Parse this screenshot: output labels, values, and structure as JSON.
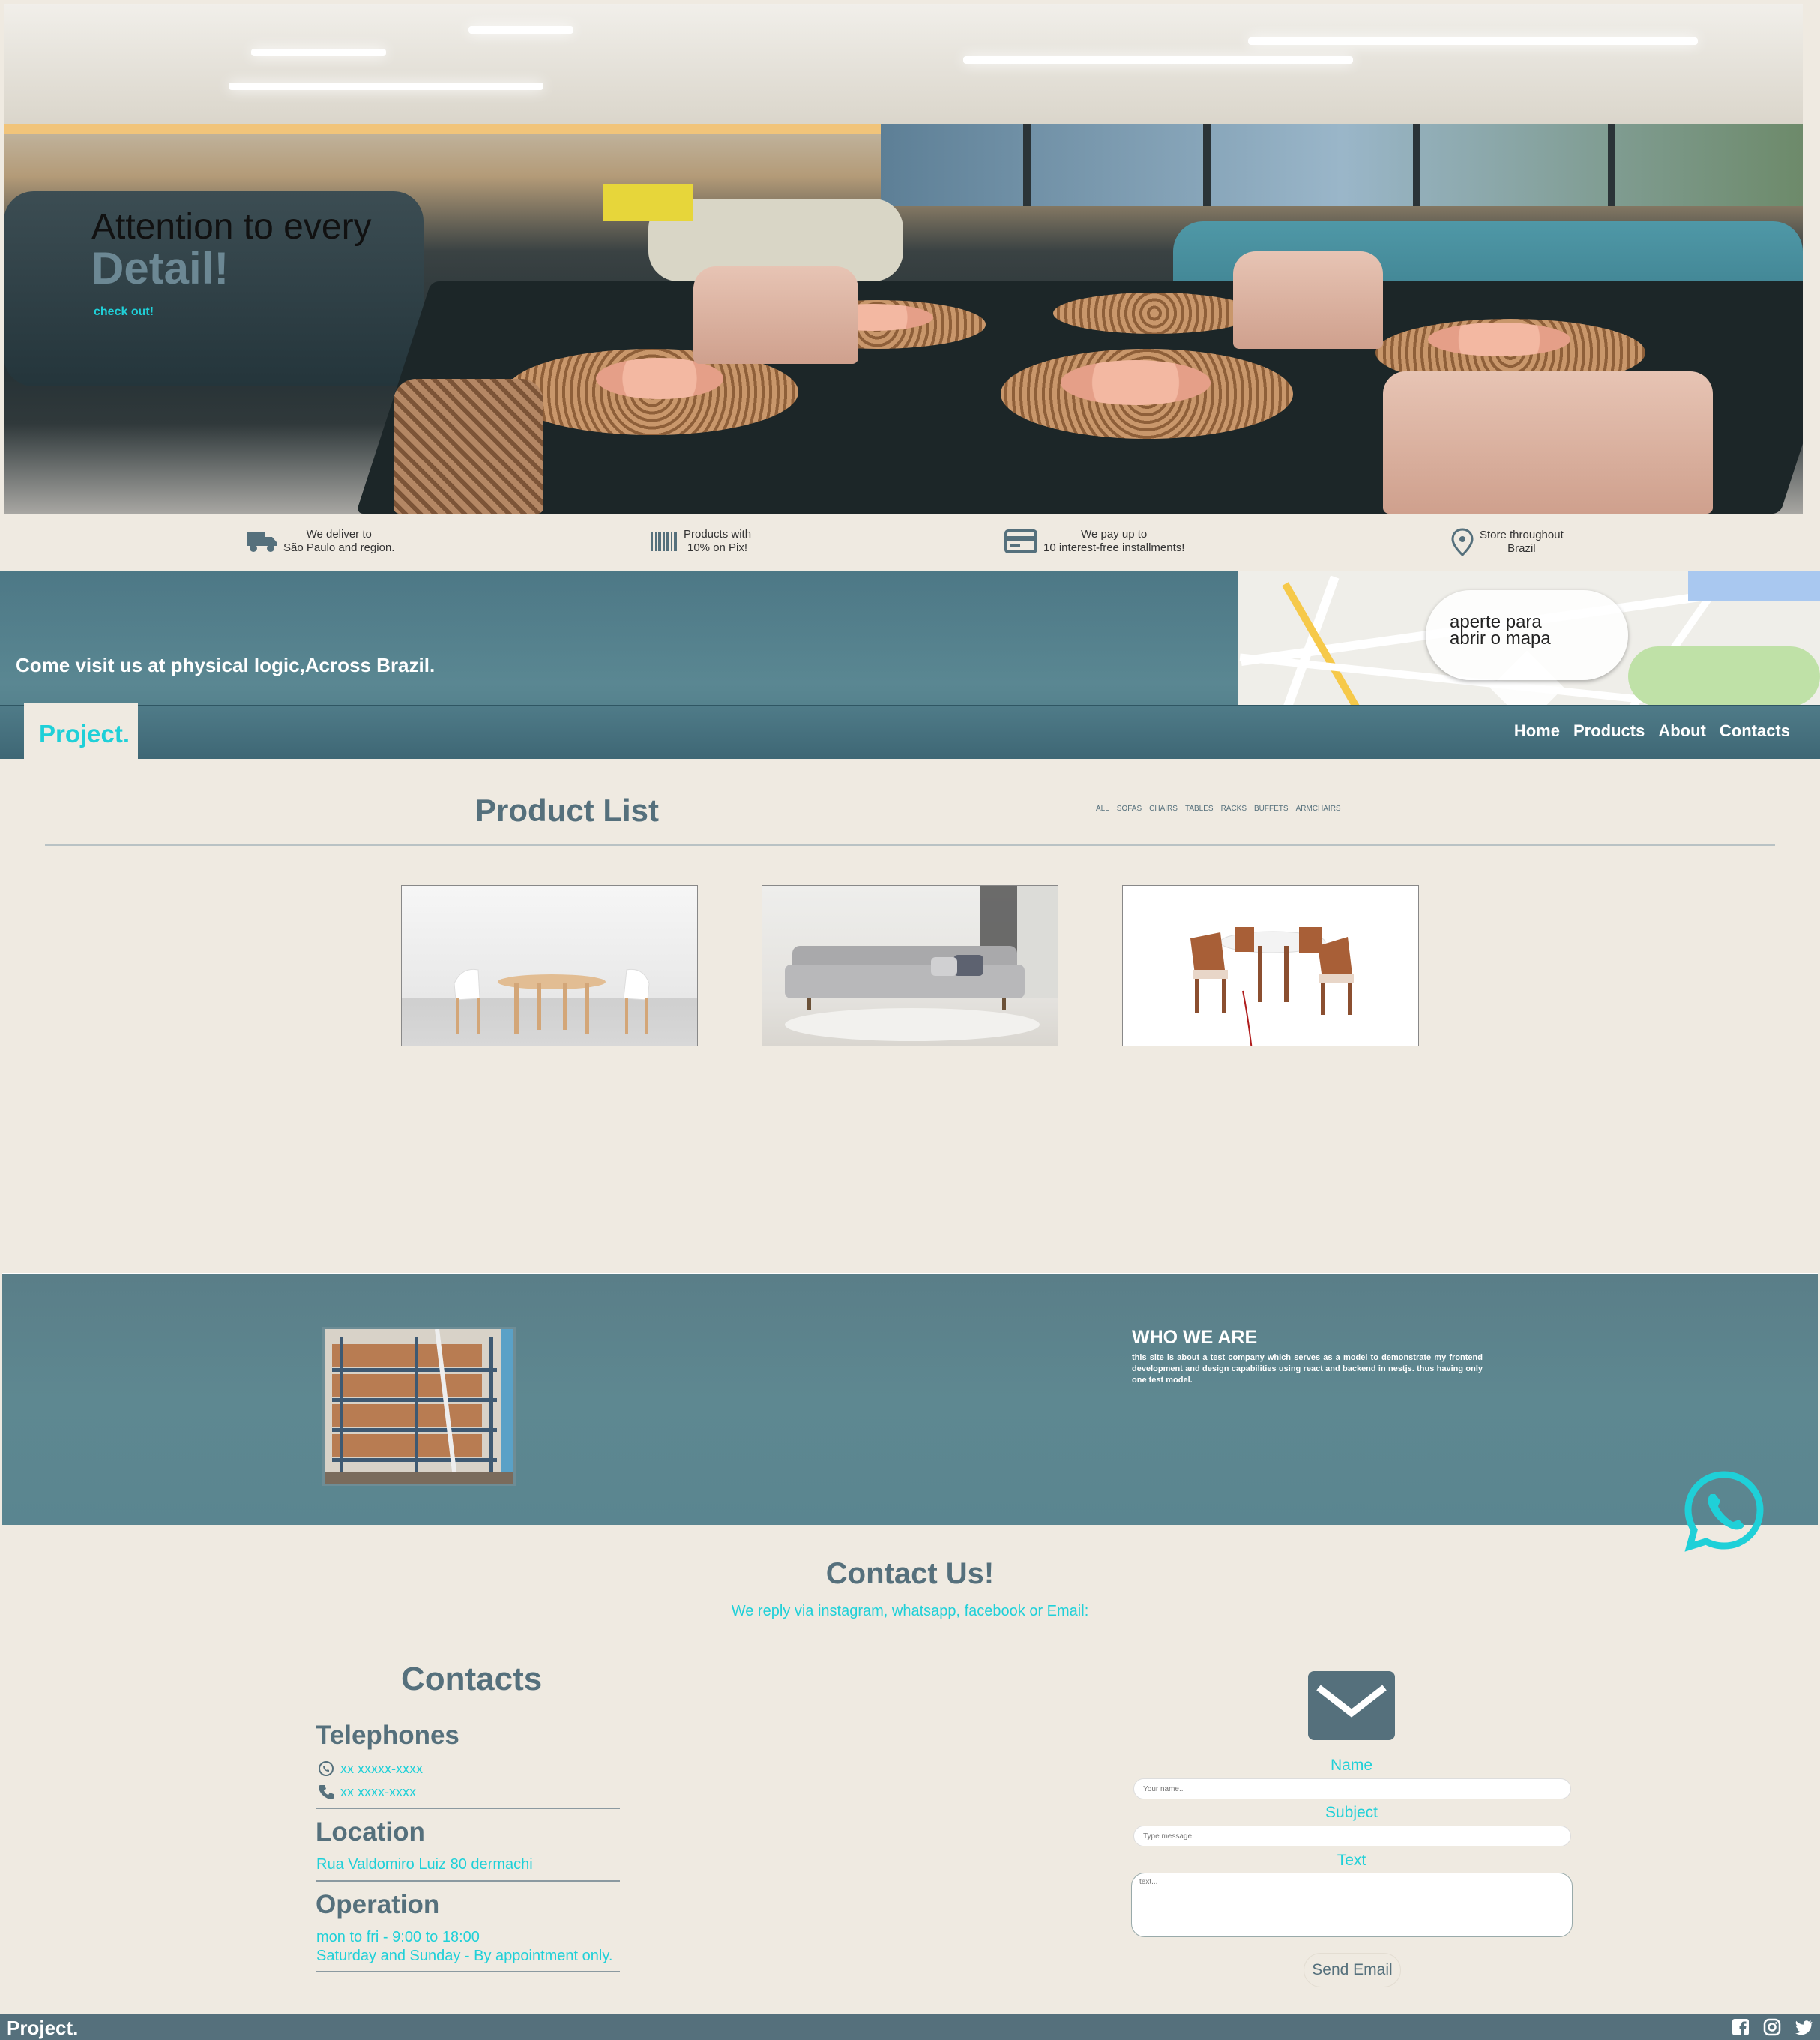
{
  "hero": {
    "line1": "Attention to every",
    "line2": "Detail!",
    "cta": "check out!"
  },
  "features": [
    {
      "icon": "truck-icon",
      "line1": "We deliver to",
      "line2": "São Paulo and region."
    },
    {
      "icon": "barcode-icon",
      "line1": "Products with",
      "line2": "10% on Pix!"
    },
    {
      "icon": "credit-card-icon",
      "line1": "We pay up to",
      "line2": "10 interest-free installments!"
    },
    {
      "icon": "location-pin-icon",
      "line1": "Store throughout",
      "line2": "Brazil"
    }
  ],
  "visit": {
    "text": "Come visit us at physical logic,Across Brazil.",
    "map_line1": "aperte para",
    "map_line2": "abrir o mapa"
  },
  "nav": {
    "logo": "Project.",
    "items": [
      "Home",
      "Products",
      "About",
      "Contacts"
    ]
  },
  "products": {
    "title": "Product List",
    "filters": [
      "ALL",
      "SOFAS",
      "CHAIRS",
      "TABLES",
      "RACKS",
      "BUFFETS",
      "ARMCHAIRS"
    ]
  },
  "who": {
    "heading": "WHO WE ARE",
    "body": "this site is about a test company which serves as a model to demonstrate my frontend development and design capabilities using react and backend in nestjs. thus having only one test model."
  },
  "contact": {
    "title": "Contact Us!",
    "subtitle": "We reply via instagram, whatsapp, facebook or Email:",
    "contacts_heading": "Contacts",
    "telephones_heading": "Telephones",
    "whatsapp": "xx xxxxx-xxxx",
    "phone": "xx xxxx-xxxx",
    "location_heading": "Location",
    "address": "Rua Valdomiro Luiz 80 dermachi",
    "operation_heading": "Operation",
    "hours_weekday": "mon to fri - 9:00 to 18:00",
    "hours_weekend": "Saturday and Sunday - By appointment only."
  },
  "form": {
    "name_label": "Name",
    "name_placeholder": "Your name..",
    "subject_label": "Subject",
    "subject_placeholder": "Type message",
    "text_label": "Text",
    "text_placeholder": "text...",
    "send": "Send Email"
  },
  "footer": {
    "logo": "Project.",
    "social": [
      "facebook-icon",
      "instagram-icon",
      "twitter-icon"
    ]
  },
  "colors": {
    "accent": "#1fd0d8",
    "slate": "#55707c",
    "background": "#efeae1",
    "teal_band": "#5a8792"
  }
}
